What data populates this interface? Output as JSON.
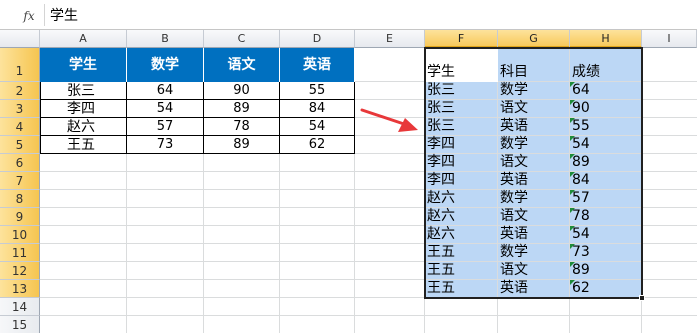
{
  "formula_bar": {
    "fx_label": "fx",
    "content": "学生"
  },
  "columns": [
    "A",
    "B",
    "C",
    "D",
    "E",
    "F",
    "G",
    "H",
    "I"
  ],
  "rows": [
    "1",
    "2",
    "3",
    "4",
    "5",
    "6",
    "7",
    "8",
    "9",
    "10",
    "11",
    "12",
    "13",
    "14",
    "15"
  ],
  "source_table": {
    "headers": [
      "学生",
      "数学",
      "语文",
      "英语"
    ],
    "rows": [
      [
        "张三",
        "64",
        "90",
        "55"
      ],
      [
        "李四",
        "54",
        "89",
        "84"
      ],
      [
        "赵六",
        "57",
        "78",
        "54"
      ],
      [
        "王五",
        "73",
        "89",
        "62"
      ]
    ]
  },
  "result_table": {
    "headers": [
      "学生",
      "科目",
      "成绩"
    ],
    "rows": [
      [
        "张三",
        "数学",
        "64"
      ],
      [
        "张三",
        "语文",
        "90"
      ],
      [
        "张三",
        "英语",
        "55"
      ],
      [
        "李四",
        "数学",
        "54"
      ],
      [
        "李四",
        "语文",
        "89"
      ],
      [
        "李四",
        "英语",
        "84"
      ],
      [
        "赵六",
        "数学",
        "57"
      ],
      [
        "赵六",
        "语文",
        "78"
      ],
      [
        "赵六",
        "英语",
        "54"
      ],
      [
        "王五",
        "数学",
        "73"
      ],
      [
        "王五",
        "语文",
        "89"
      ],
      [
        "王五",
        "英语",
        "62"
      ]
    ]
  },
  "colors": {
    "header_fill": "#0070c0",
    "selection_fill": "#bcd7f5",
    "arrow": "#e8383a",
    "number_flag": "#1e8c3a"
  }
}
